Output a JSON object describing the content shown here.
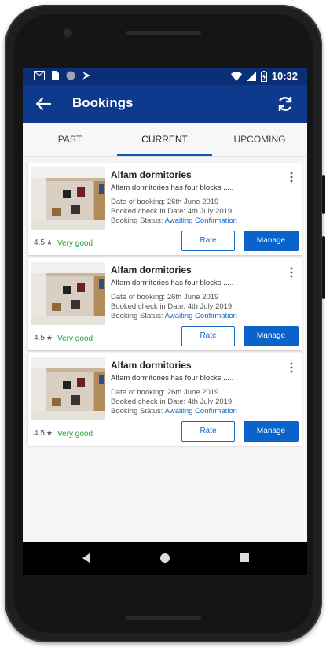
{
  "status_bar": {
    "time": "10:32"
  },
  "app_bar": {
    "title": "Bookings"
  },
  "tabs": [
    {
      "label": "PAST"
    },
    {
      "label": "CURRENT"
    },
    {
      "label": "UPCOMING"
    }
  ],
  "bookings": [
    {
      "title": "Alfam dormitories",
      "description": "Alfam dormitories has four blocks .....",
      "date_of_booking": "Date of booking: 26th June 2019",
      "check_in": "Booked check in Date: 4th July 2019",
      "status_label": "Booking Status:",
      "status_value": "Awaiting Confirmation",
      "rating": "4.5",
      "rating_text": "Very good",
      "rate_label": "Rate",
      "manage_label": "Manage"
    },
    {
      "title": "Alfam dormitories",
      "description": "Alfam dormitories has four blocks .....",
      "date_of_booking": "Date of booking: 26th June 2019",
      "check_in": "Booked check in Date: 4th July 2019",
      "status_label": "Booking Status:",
      "status_value": "Awaiting Confirmation",
      "rating": "4.5",
      "rating_text": "Very good",
      "rate_label": "Rate",
      "manage_label": "Manage"
    },
    {
      "title": "Alfam dormitories",
      "description": "Alfam dormitories has four blocks .....",
      "date_of_booking": "Date of booking: 26th June 2019",
      "check_in": "Booked check in Date: 4th July 2019",
      "status_label": "Booking Status:",
      "status_value": "Awaiting Confirmation",
      "rating": "4.5",
      "rating_text": "Very good",
      "rate_label": "Rate",
      "manage_label": "Manage"
    }
  ],
  "colors": {
    "status_bar": "#0b2f74",
    "app_bar": "#0d3a8c",
    "accent": "#0a63c9",
    "rating_good": "#2e9e3e"
  },
  "icons": {
    "back": "arrow-left-icon",
    "refresh": "refresh-icon",
    "more": "more-vert-icon"
  }
}
